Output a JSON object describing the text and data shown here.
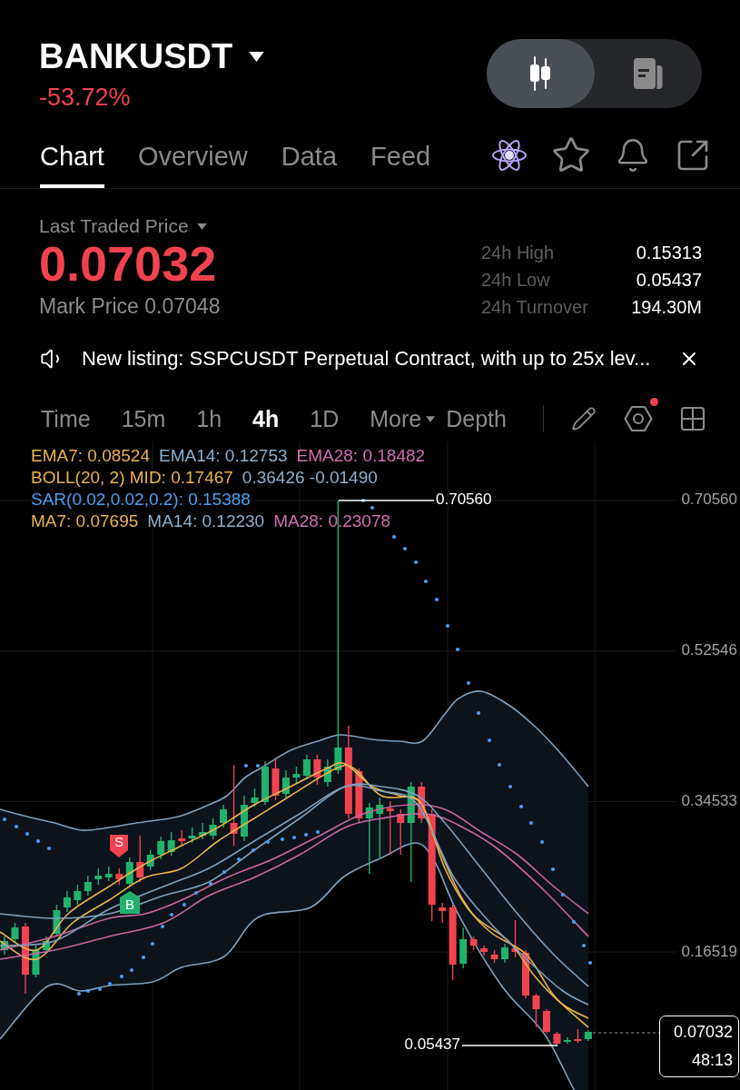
{
  "header": {
    "symbol": "BANKUSDT",
    "change": "-53.72%",
    "view_toggle": [
      {
        "kind": "chart",
        "selected": true
      },
      {
        "kind": "info",
        "selected": false
      }
    ]
  },
  "tabs": [
    {
      "label": "Chart",
      "selected": true
    },
    {
      "label": "Overview",
      "selected": false
    },
    {
      "label": "Data",
      "selected": false
    },
    {
      "label": "Feed",
      "selected": false
    }
  ],
  "price": {
    "label": "Last Traded Price",
    "last": "0.07032",
    "mark": "Mark Price 0.07048"
  },
  "stats": [
    {
      "label": "24h High",
      "value": "0.15313"
    },
    {
      "label": "24h Low",
      "value": "0.05437"
    },
    {
      "label": "24h Turnover",
      "value": "194.30M"
    }
  ],
  "notice": "New listing: SSPCUSDT Perpetual Contract, with up to 25x lev...",
  "intervals": [
    {
      "label": "Time",
      "kind": "option",
      "selected": false
    },
    {
      "label": "15m",
      "kind": "option",
      "selected": false
    },
    {
      "label": "1h",
      "kind": "option",
      "selected": false
    },
    {
      "label": "4h",
      "kind": "option",
      "selected": true
    },
    {
      "label": "1D",
      "kind": "option",
      "selected": false
    },
    {
      "label": "More",
      "kind": "dropdown",
      "selected": false
    },
    {
      "label": "Depth",
      "kind": "option",
      "selected": false
    }
  ],
  "toolbar": {
    "settings_alert": true
  },
  "chart": {
    "legend": [
      [
        {
          "text": "EMA7: 0.08524",
          "color": "#e9b44c"
        },
        {
          "text": "EMA14: 0.12753",
          "color": "#8fb0cc"
        },
        {
          "text": "EMA28: 0.18482",
          "color": "#d26fb1"
        }
      ],
      [
        {
          "text": "BOLL(20, 2) MID: 0.17467",
          "color": "#e9b44c"
        },
        {
          "text": "0.36426 -0.01490",
          "color": "#8fb0cc"
        }
      ],
      [
        {
          "text": "SAR(0.02,0.02,0.2): 0.15388",
          "color": "#4a9ff0"
        }
      ],
      [
        {
          "text": "MA7: 0.07695",
          "color": "#e9b44c"
        },
        {
          "text": "MA14: 0.12230",
          "color": "#8fb0cc"
        },
        {
          "text": "MA28: 0.23078",
          "color": "#d26fb1"
        }
      ]
    ],
    "price_axis": [
      "0.70560",
      "0.52546",
      "0.34533",
      "0.16519"
    ],
    "high_label": "0.70560",
    "low_label": "0.05437",
    "last_price": "0.07032",
    "countdown": "48:13",
    "signals": [
      {
        "kind": "sell",
        "label": "S"
      },
      {
        "kind": "buy",
        "label": "B"
      }
    ]
  }
}
